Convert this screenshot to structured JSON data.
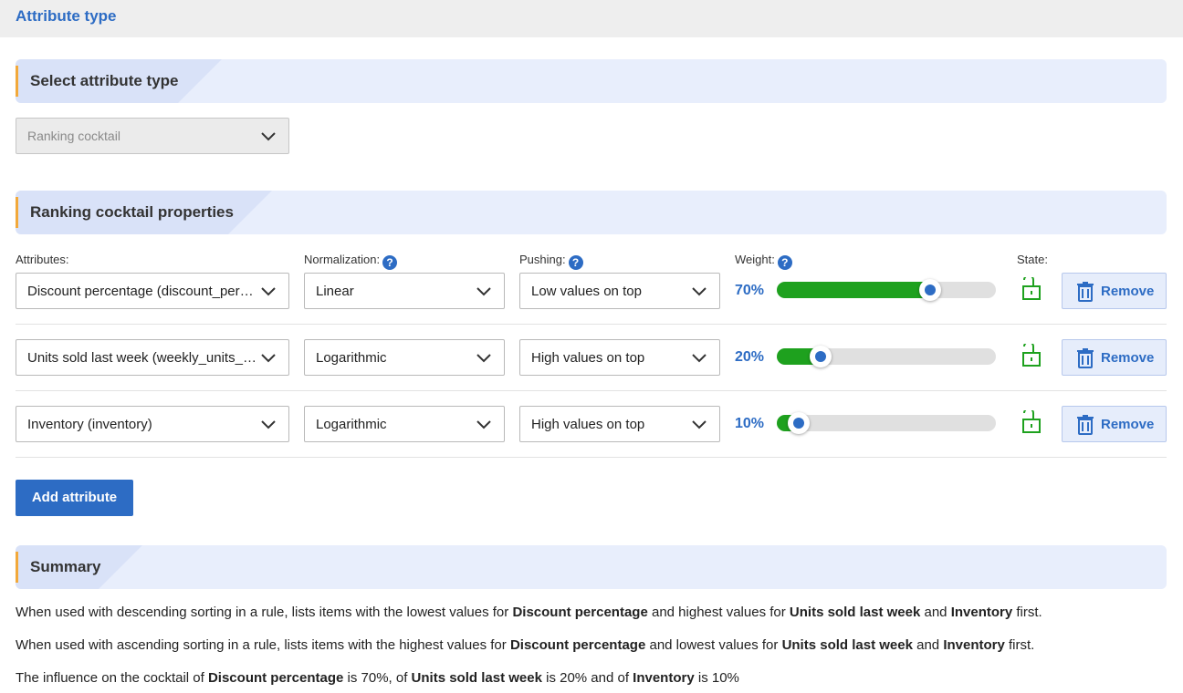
{
  "header": {
    "title": "Attribute type"
  },
  "sections": {
    "select_type": "Select attribute type",
    "properties": "Ranking cocktail properties",
    "summary": "Summary"
  },
  "attribute_type_select": {
    "value": "Ranking cocktail",
    "disabled": true
  },
  "columns": {
    "attributes": "Attributes:",
    "normalization": "Normalization:",
    "pushing": "Pushing:",
    "weight": "Weight:",
    "state": "State:"
  },
  "rows": [
    {
      "attribute": "Discount percentage (discount_perc...",
      "normalization": "Linear",
      "pushing": "Low values on top",
      "weight_label": "70%",
      "weight": 0.7,
      "state": "unlocked",
      "remove_label": "Remove"
    },
    {
      "attribute": "Units sold last week (weekly_units_s...",
      "normalization": "Logarithmic",
      "pushing": "High values on top",
      "weight_label": "20%",
      "weight": 0.2,
      "state": "unlocked",
      "remove_label": "Remove"
    },
    {
      "attribute": "Inventory (inventory)",
      "normalization": "Logarithmic",
      "pushing": "High values on top",
      "weight_label": "10%",
      "weight": 0.1,
      "state": "unlocked",
      "remove_label": "Remove"
    }
  ],
  "add_button": "Add attribute",
  "summary": {
    "line1": [
      "When used with descending sorting in a rule, lists items with the lowest values for ",
      "Discount percentage",
      " and highest values for ",
      "Units sold last week",
      " and ",
      "Inventory",
      " first."
    ],
    "line2": [
      "When used with ascending sorting in a rule, lists items with the highest values for ",
      "Discount percentage",
      " and lowest values for ",
      "Units sold last week",
      " and ",
      "Inventory",
      " first."
    ],
    "line3": [
      "The influence on the cocktail of ",
      "Discount percentage",
      " is 70%, of ",
      "Units sold last week",
      " is 20% and of ",
      "Inventory",
      " is 10%"
    ]
  },
  "colors": {
    "accent": "#2d6cc4",
    "orange": "#f2a93b",
    "green": "#1ea11e"
  }
}
